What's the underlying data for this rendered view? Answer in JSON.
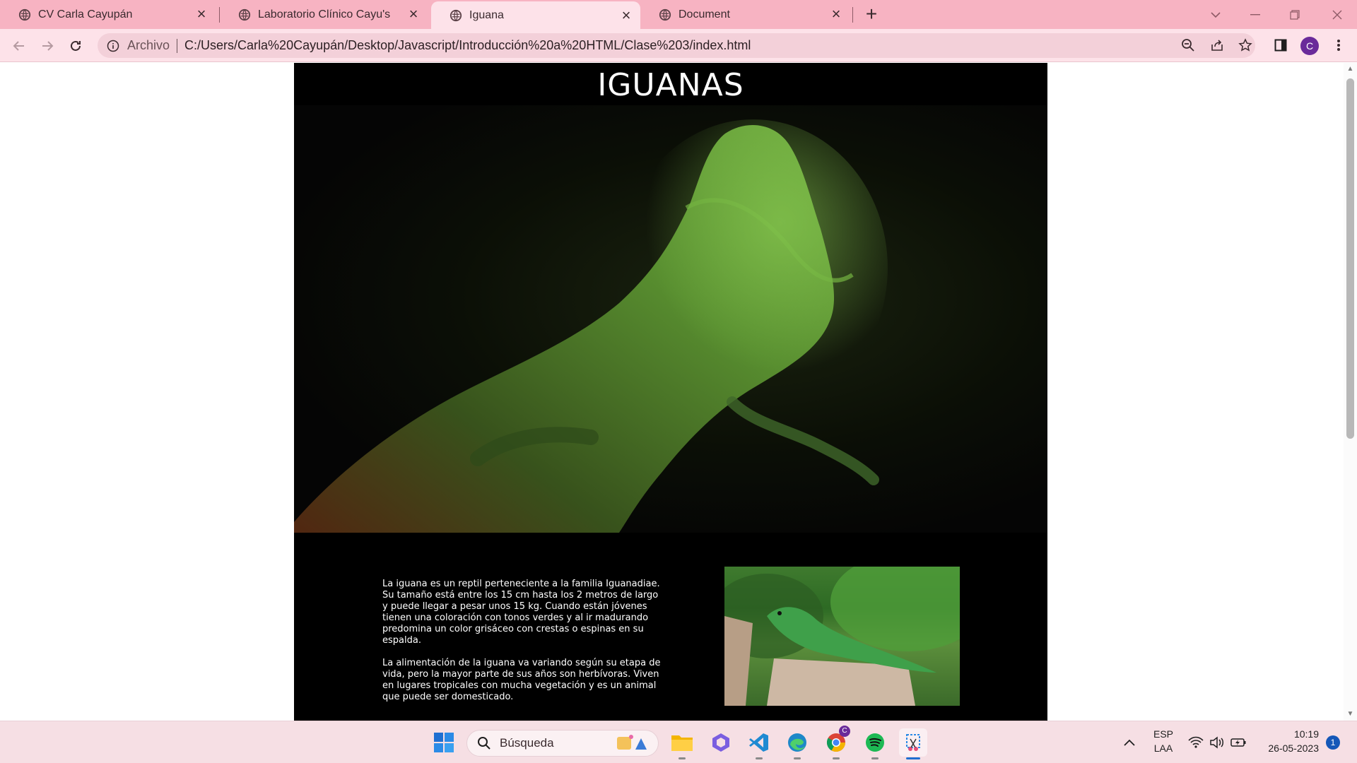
{
  "tabs": [
    {
      "title": "CV Carla Cayupán",
      "active": false
    },
    {
      "title": "Laboratorio Clínico Cayu's",
      "active": false
    },
    {
      "title": "Iguana",
      "active": true
    },
    {
      "title": "Document",
      "active": false
    }
  ],
  "address_bar": {
    "scheme_label": "Archivo",
    "url": "C:/Users/Carla%20Cayupán/Desktop/Javascript/Introducción%20a%20HTML/Clase%203/index.html"
  },
  "profile": {
    "initial": "C"
  },
  "page": {
    "title": "IGUANAS",
    "paragraphs": [
      "La iguana es un reptil perteneciente a la familia Iguanadiae. Su tamaño está entre los 15 cm hasta los 2 metros de largo y puede llegar a pesar unos 15 kg. Cuando están jóvenes tienen una coloración con tonos verdes y al ir madurando predomina un color grisáceo con crestas o espinas en su espalda.",
      "La alimentación de la iguana va variando según su etapa de vida, pero la mayor parte de sus años son herbívoras. Viven en lugares tropicales con mucha vegetación y es un animal que puede ser domesticado."
    ]
  },
  "taskbar": {
    "search_label": "Búsqueda",
    "language": "ESP",
    "layout": "LAA",
    "time": "10:19",
    "date": "26-05-2023",
    "notifications": "1",
    "chrome_badge": "C"
  },
  "colors": {
    "tabstrip": "#f7b3c2",
    "toolbar": "#fde2e9",
    "page_bg": "#000000",
    "title": "#ffffff"
  }
}
